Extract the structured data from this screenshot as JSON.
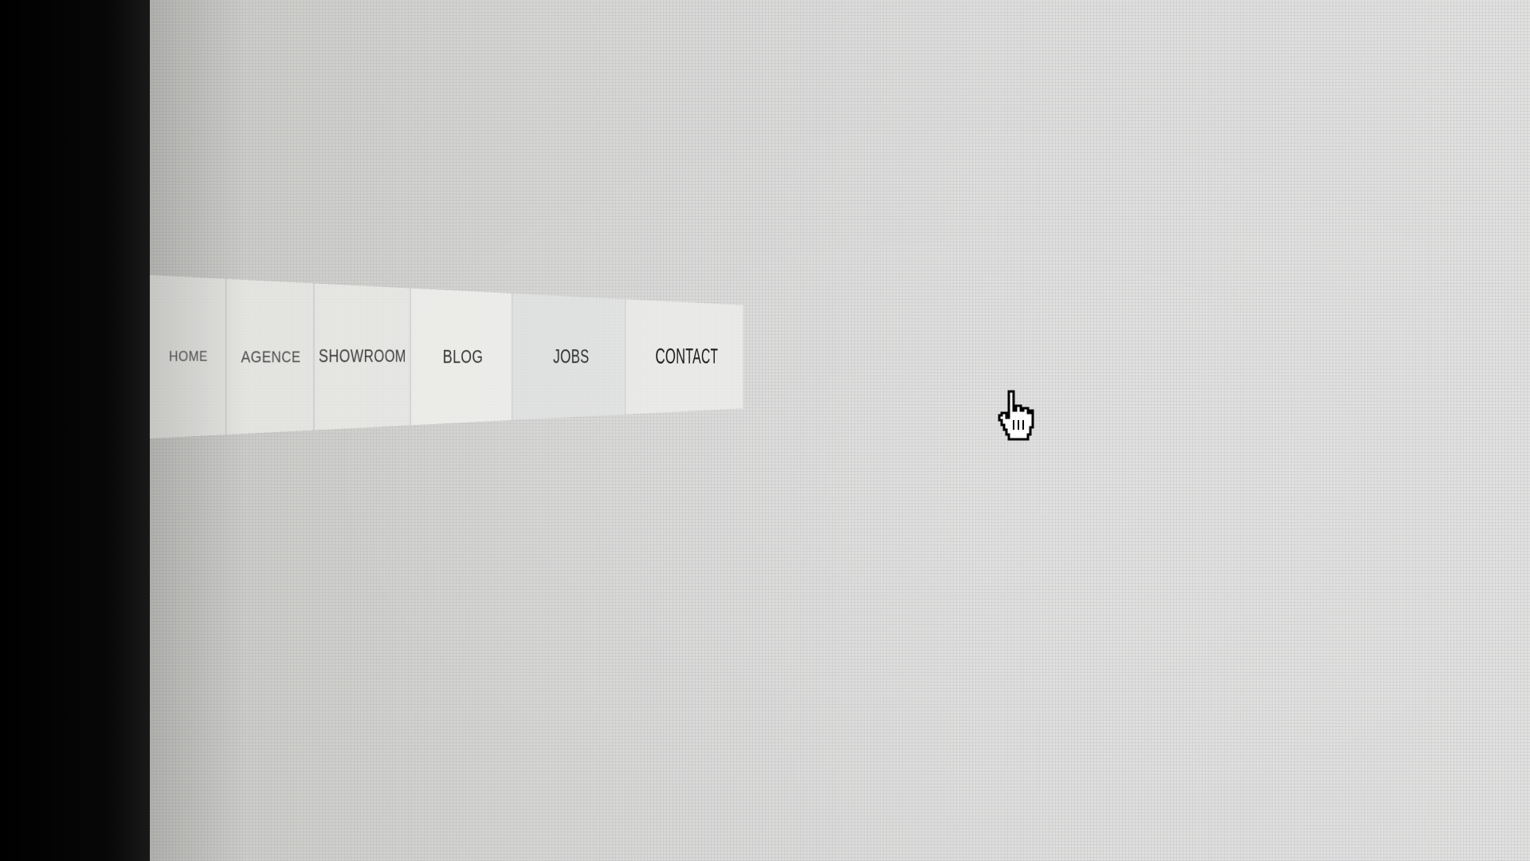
{
  "navigation": {
    "items": [
      {
        "label": "HOME"
      },
      {
        "label": "AGENCE"
      },
      {
        "label": "SHOWROOM"
      },
      {
        "label": "BLOG"
      },
      {
        "label": "JOBS"
      },
      {
        "label": "CONTACT"
      }
    ]
  },
  "cursor": {
    "icon": "hand-pointer-icon"
  }
}
